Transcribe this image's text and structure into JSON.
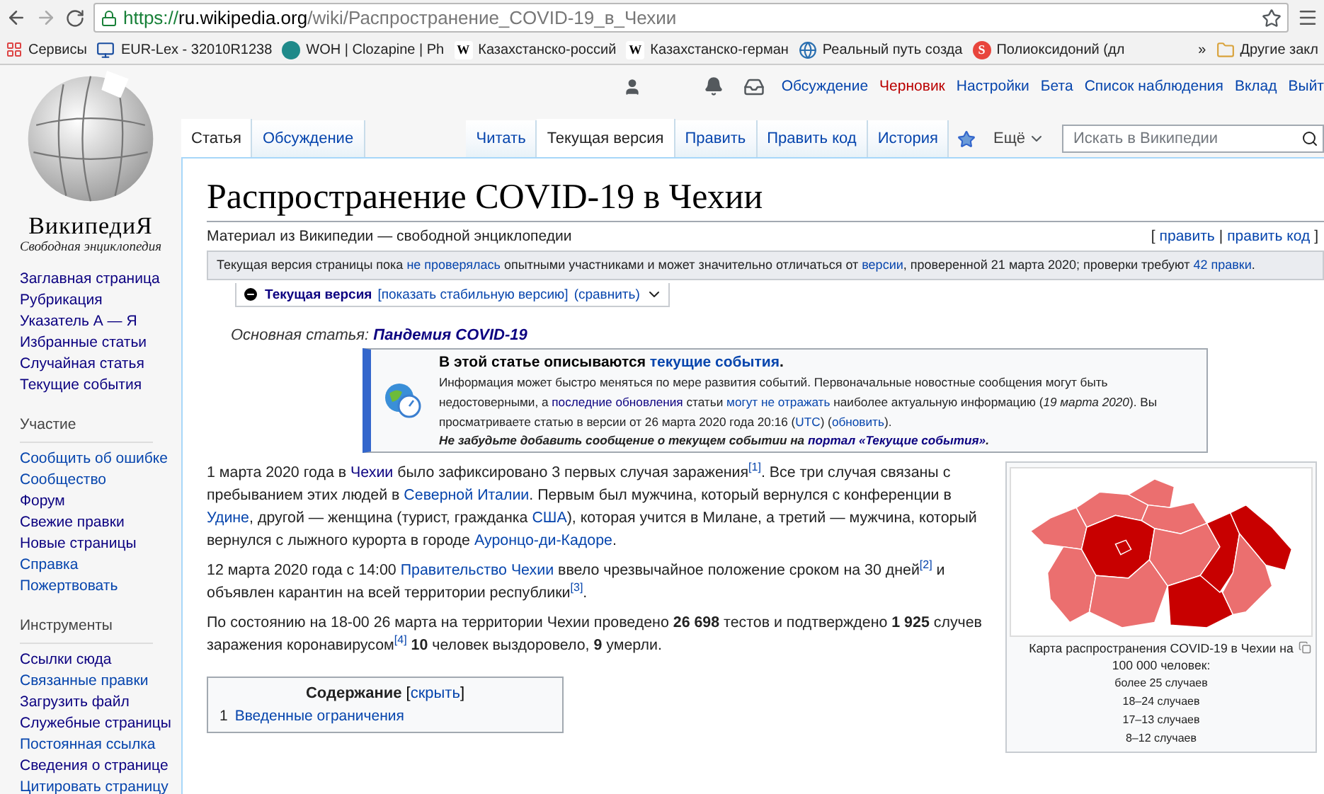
{
  "browser": {
    "url": {
      "scheme": "https://",
      "host": "ru.wikipedia.org",
      "path": "/wiki/Распространение_COVID-19_в_Чехии"
    },
    "bookmarks": [
      {
        "kind": "apps",
        "label": "Сервисы"
      },
      {
        "kind": "monitor",
        "label": "EUR-Lex - 32010R1238"
      },
      {
        "kind": "circle",
        "label": "WOH | Clozapine | Ph"
      },
      {
        "kind": "letter",
        "glyph": "W",
        "label": "Казахстанско-россий"
      },
      {
        "kind": "letter",
        "glyph": "W",
        "label": "Казахстанско-герман"
      },
      {
        "kind": "globe",
        "label": "Реальный путь созда"
      },
      {
        "kind": "badge",
        "glyph": "S",
        "label": "Полиоксидоний (дл"
      }
    ],
    "overflow": "»",
    "other_bookmarks": "Другие закл"
  },
  "sidebar": {
    "wordmark": "ВикипедиЯ",
    "tagline": "Свободная энциклопедия",
    "groups": [
      {
        "items": [
          {
            "label": "Заглавная страница",
            "visited": true
          },
          {
            "label": "Рубрикация",
            "visited": true
          },
          {
            "label": "Указатель А — Я",
            "visited": true
          },
          {
            "label": "Избранные статьи",
            "visited": true
          },
          {
            "label": "Случайная статья",
            "visited": true
          },
          {
            "label": "Текущие события",
            "visited": true
          }
        ]
      },
      {
        "heading": "Участие",
        "items": [
          {
            "label": "Сообщить об ошибке",
            "visited": false
          },
          {
            "label": "Сообщество",
            "visited": false
          },
          {
            "label": "Форум",
            "visited": true
          },
          {
            "label": "Свежие правки",
            "visited": true
          },
          {
            "label": "Новые страницы",
            "visited": true
          },
          {
            "label": "Справка",
            "visited": false
          },
          {
            "label": "Пожертвовать",
            "visited": false
          }
        ]
      },
      {
        "heading": "Инструменты",
        "items": [
          {
            "label": "Ссылки сюда",
            "visited": true
          },
          {
            "label": "Связанные правки",
            "visited": false
          },
          {
            "label": "Загрузить файл",
            "visited": true
          },
          {
            "label": "Служебные страницы",
            "visited": true
          },
          {
            "label": "Постоянная ссылка",
            "visited": false
          },
          {
            "label": "Сведения о странице",
            "visited": true
          },
          {
            "label": "Цитировать страницу",
            "visited": false
          }
        ]
      }
    ]
  },
  "personal_tools": [
    {
      "label": "Обсуждение",
      "kind": "link"
    },
    {
      "label": "Черновик",
      "kind": "new"
    },
    {
      "label": "Настройки",
      "kind": "link"
    },
    {
      "label": "Бета",
      "kind": "link"
    },
    {
      "label": "Список наблюдения",
      "kind": "link"
    },
    {
      "label": "Вклад",
      "kind": "link"
    },
    {
      "label": "Выйт",
      "kind": "link"
    }
  ],
  "namespace_tabs": [
    {
      "label": "Статья",
      "selected": true
    },
    {
      "label": "Обсуждение",
      "selected": false
    }
  ],
  "view_tabs": [
    {
      "label": "Читать",
      "selected": false
    },
    {
      "label": "Текущая версия",
      "selected": true
    },
    {
      "label": "Править",
      "selected": false
    },
    {
      "label": "Править код",
      "selected": false
    },
    {
      "label": "История",
      "selected": false
    }
  ],
  "watched": true,
  "more_menu": "Ещё",
  "search": {
    "placeholder": "Искать в Википедии"
  },
  "title": "Распространение COVID-19 в Чехии",
  "tagline": "Материал из Википедии — свободной энциклопедии",
  "edit_links": [
    {
      "kind": "text",
      "text": "["
    },
    {
      "kind": "link",
      "text": "править"
    },
    {
      "kind": "text",
      "text": "|"
    },
    {
      "kind": "link",
      "text": "править код"
    },
    {
      "kind": "text",
      "text": "]"
    }
  ],
  "review_notice": [
    {
      "kind": "text",
      "text": "Текущая версия страницы пока "
    },
    {
      "kind": "link",
      "text": "не проверялась"
    },
    {
      "kind": "text",
      "text": " опытными участниками и может значительно отличаться от "
    },
    {
      "kind": "link",
      "text": "версии"
    },
    {
      "kind": "text",
      "text": ", проверенной 21 марта 2020; проверки требуют "
    },
    {
      "kind": "link",
      "text": "42 правки"
    },
    {
      "kind": "text",
      "text": "."
    }
  ],
  "version_bar": {
    "current": "Текущая версия",
    "show_stable": "[показать стабильную версию]",
    "compare": "(сравнить)"
  },
  "hatnote": {
    "label": "Основная статья: ",
    "link": "Пандемия COVID-19"
  },
  "current_events": {
    "heading": [
      {
        "kind": "text",
        "text": "В этой статье описываются "
      },
      {
        "kind": "link",
        "text": "текущие события"
      },
      {
        "kind": "text",
        "text": "."
      }
    ],
    "body": [
      {
        "kind": "text",
        "text": "Информация может быстро меняться по мере развития событий. Первоначальные новостные сообщения могут быть недостоверными, а "
      },
      {
        "kind": "visited",
        "text": "последние обновления"
      },
      {
        "kind": "text",
        "text": " статьи "
      },
      {
        "kind": "link",
        "text": "могут не отражать"
      },
      {
        "kind": "text",
        "text": " наиболее актуальную информацию (*19 марта 2020*). Вы просматриваете статью в версии от 26 марта 2020 года 20:16 ("
      },
      {
        "kind": "link",
        "text": "UTC"
      },
      {
        "kind": "text",
        "text": ") ("
      },
      {
        "kind": "link",
        "text": "обновить"
      },
      {
        "kind": "text",
        "text": ")."
      }
    ],
    "footer": [
      {
        "kind": "text",
        "text": "Не забудьте добавить сообщение о текущем событии на "
      },
      {
        "kind": "visited",
        "text": "портал «Текущие события»"
      },
      {
        "kind": "text",
        "text": "."
      }
    ]
  },
  "paragraphs": [
    [
      {
        "kind": "text",
        "text": "1 марта 2020 года в "
      },
      {
        "kind": "visited",
        "text": "Чехии"
      },
      {
        "kind": "text",
        "text": " было зафиксировано 3 первых случая заражения"
      },
      {
        "kind": "ref",
        "text": "[1]"
      },
      {
        "kind": "text",
        "text": ". Все три случая связаны с пребыванием этих людей в "
      },
      {
        "kind": "link",
        "text": "Северной Италии"
      },
      {
        "kind": "text",
        "text": ". Первым был мужчина, который вернулся с конференции в "
      },
      {
        "kind": "link",
        "text": "Удине"
      },
      {
        "kind": "text",
        "text": ", другой — женщина (турист, гражданка "
      },
      {
        "kind": "link",
        "text": "США"
      },
      {
        "kind": "text",
        "text": "), которая учится в Милане, а третий — мужчина, который вернулся с лыжного курорта в городе "
      },
      {
        "kind": "link",
        "text": "Ауронцо-ди-Кадоре"
      },
      {
        "kind": "text",
        "text": "."
      }
    ],
    [
      {
        "kind": "text",
        "text": "12 марта 2020 года с 14:00 "
      },
      {
        "kind": "link",
        "text": "Правительство Чехии"
      },
      {
        "kind": "text",
        "text": " ввело чрезвычайное положение сроком на 30 дней"
      },
      {
        "kind": "ref",
        "text": "[2]"
      },
      {
        "kind": "text",
        "text": " и объявлен карантин на всей территории республики"
      },
      {
        "kind": "ref",
        "text": "[3]"
      },
      {
        "kind": "text",
        "text": "."
      }
    ],
    [
      {
        "kind": "text",
        "text": "По состоянию на 18-00 26 марта на территории Чехии проведено **26 698** тестов и подтверждено **1 925** случев заражения коронавирусом"
      },
      {
        "kind": "ref",
        "text": "[4]"
      },
      {
        "kind": "text",
        "text": " **10** человек выздоровело, **9** умерли."
      }
    ]
  ],
  "toc": {
    "title": "Содержание",
    "toggle_open": "[",
    "toggle": "скрыть",
    "toggle_close": "]",
    "items": [
      {
        "number": "1",
        "label": "Введенные ограничения"
      }
    ]
  },
  "infobox": {
    "caption": "Карта распространения COVID-19 в Чехии на 100 000 человек:",
    "legend": [
      "более 25 случаев",
      "18–24 случаев",
      "17–13 случаев",
      "8–12 случаев"
    ]
  }
}
